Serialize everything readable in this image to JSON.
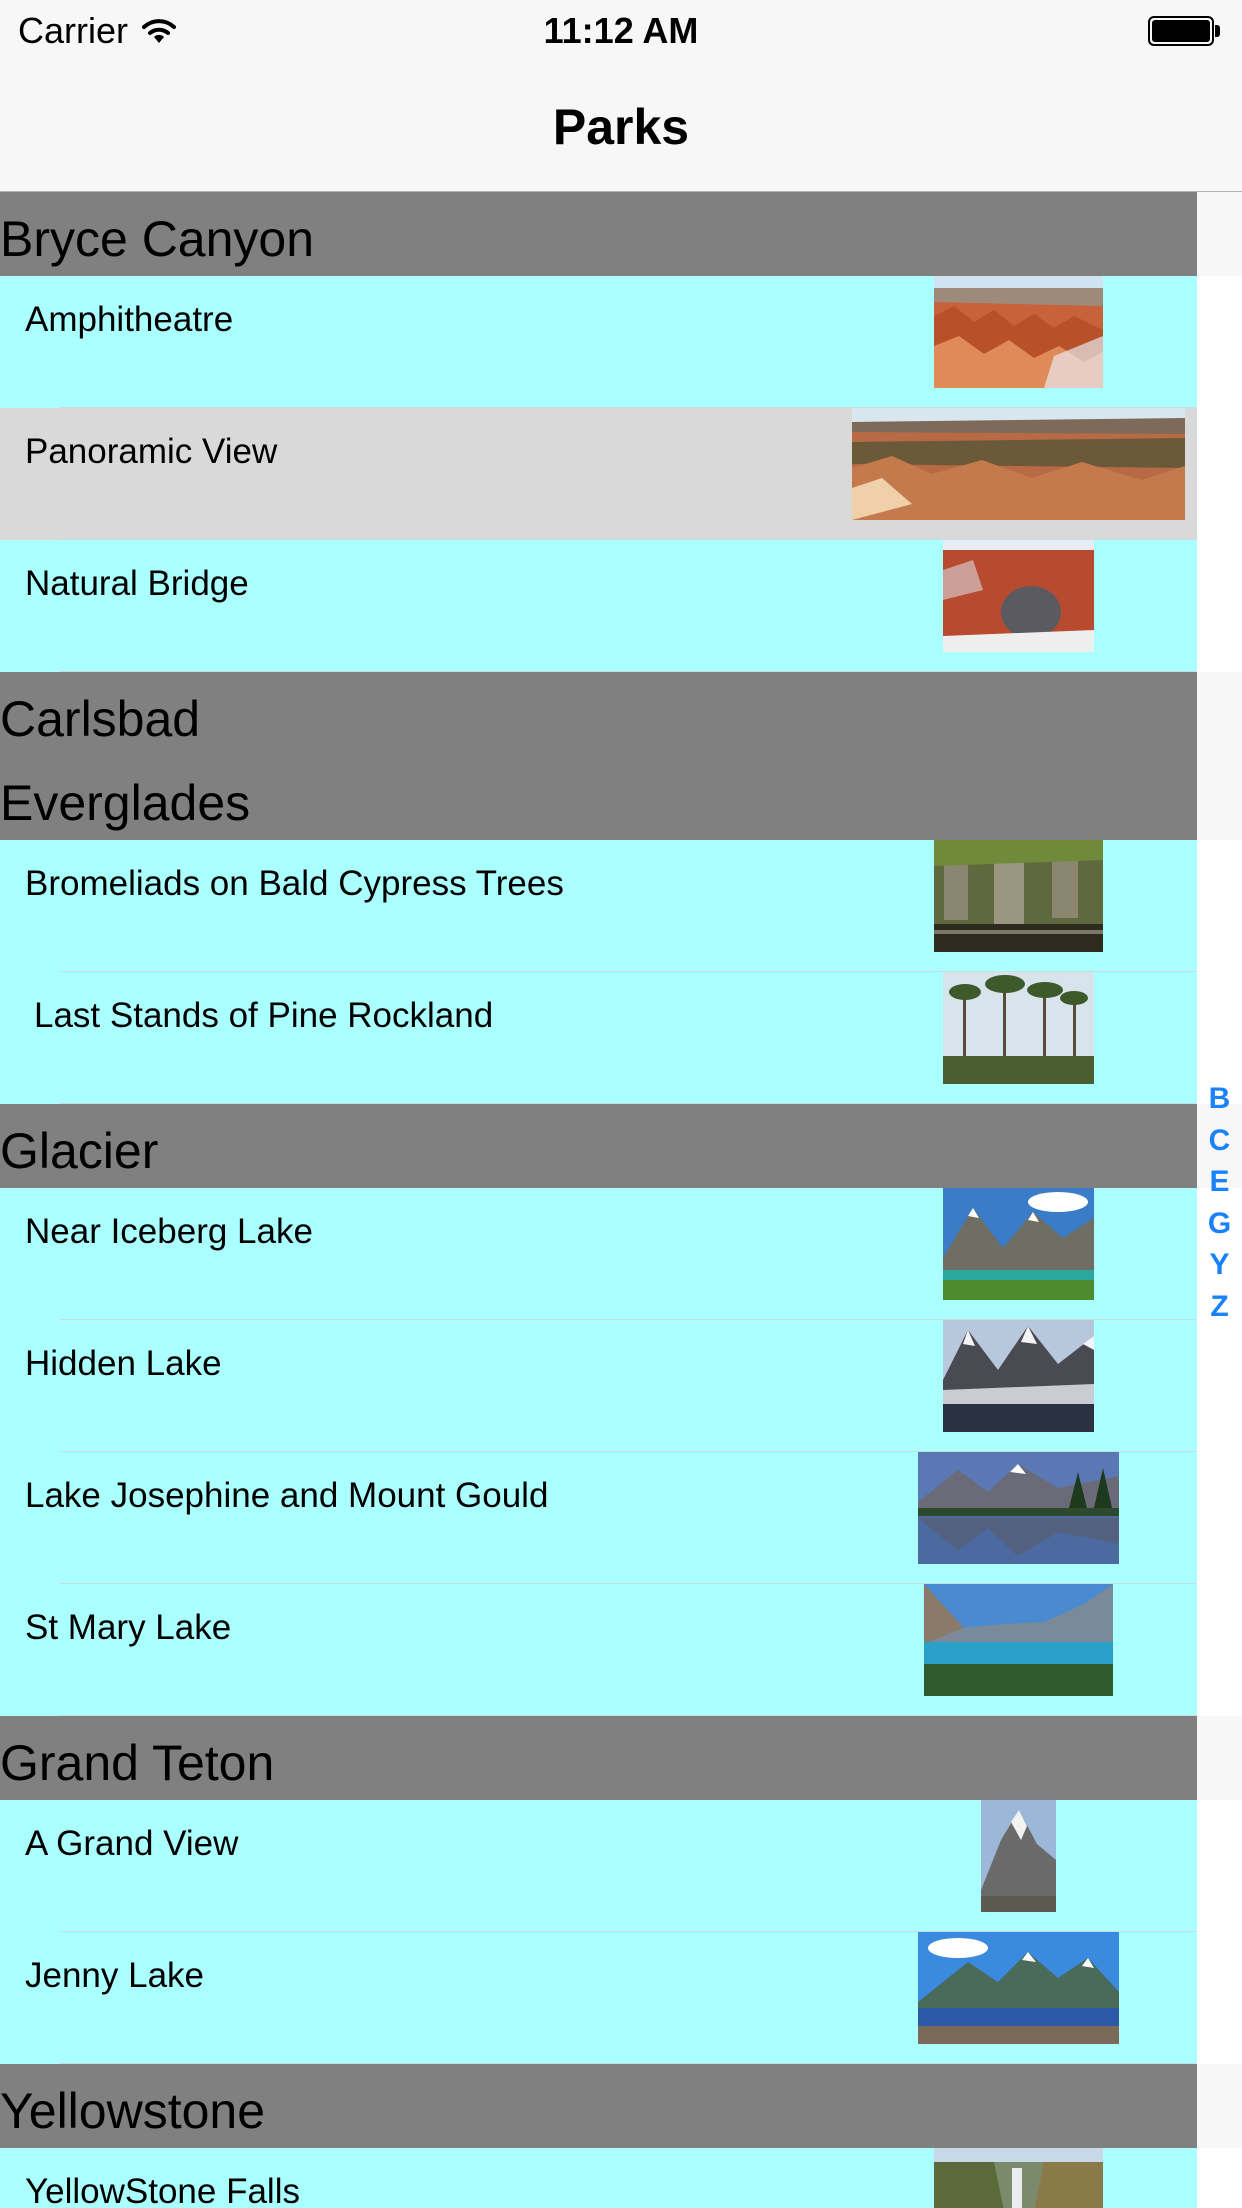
{
  "status_bar": {
    "carrier": "Carrier",
    "time": "11:12 AM"
  },
  "nav": {
    "title": "Parks"
  },
  "colors": {
    "header_bg": "#808080",
    "row_bg": "#aaffff",
    "selected_row_bg": "#d9d9d9",
    "index_color": "#1a82fb"
  },
  "sections": [
    {
      "title": "Bryce Canyon",
      "rows": [
        {
          "label": "Amphitheatre",
          "icon": "bryce-amphitheatre-photo"
        },
        {
          "label": "Panoramic View",
          "icon": "bryce-panorama-photo",
          "selected": true
        },
        {
          "label": "Natural Bridge",
          "icon": "bryce-natural-bridge-photo"
        }
      ]
    },
    {
      "title": "Carlsbad",
      "rows": []
    },
    {
      "title": "Everglades",
      "rows": [
        {
          "label": "Bromeliads on Bald Cypress Trees",
          "icon": "cypress-trees-photo"
        },
        {
          "label": "Last Stands of Pine Rockland",
          "icon": "pine-rockland-photo"
        }
      ]
    },
    {
      "title": "Glacier",
      "rows": [
        {
          "label": "Near Iceberg Lake",
          "icon": "iceberg-lake-photo"
        },
        {
          "label": "Hidden Lake",
          "icon": "hidden-lake-photo"
        },
        {
          "label": "Lake Josephine and Mount Gould",
          "icon": "lake-josephine-photo"
        },
        {
          "label": "St Mary Lake",
          "icon": "st-mary-lake-photo"
        }
      ]
    },
    {
      "title": "Grand Teton",
      "rows": [
        {
          "label": "A Grand View",
          "icon": "grand-teton-peak-photo"
        },
        {
          "label": "Jenny Lake",
          "icon": "jenny-lake-photo"
        }
      ]
    },
    {
      "title": "Yellowstone",
      "rows": [
        {
          "label": "YellowStone Falls",
          "icon": "yellowstone-falls-photo"
        }
      ]
    }
  ],
  "section_index": [
    "B",
    "C",
    "E",
    "G",
    "Y",
    "Z"
  ]
}
